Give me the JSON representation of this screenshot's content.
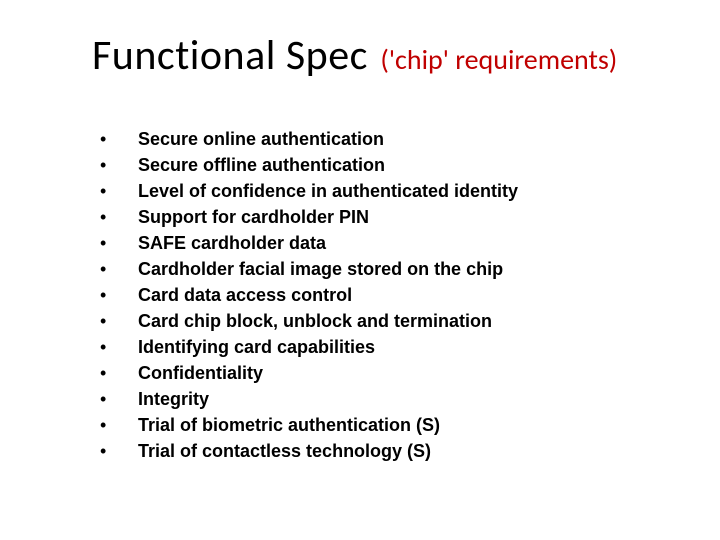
{
  "title": {
    "main": "Functional Spec",
    "sub": "('chip' requirements)"
  },
  "bullets": [
    "Secure online authentication",
    "Secure offline authentication",
    "Level of confidence in authenticated identity",
    "Support for cardholder PIN",
    "SAFE cardholder data",
    "Cardholder facial image stored on the chip",
    "Card data access control",
    "Card chip block, unblock and termination",
    "Identifying card capabilities",
    "Confidentiality",
    "Integrity",
    "Trial of biometric authentication (S)",
    "Trial of contactless technology (S)"
  ]
}
